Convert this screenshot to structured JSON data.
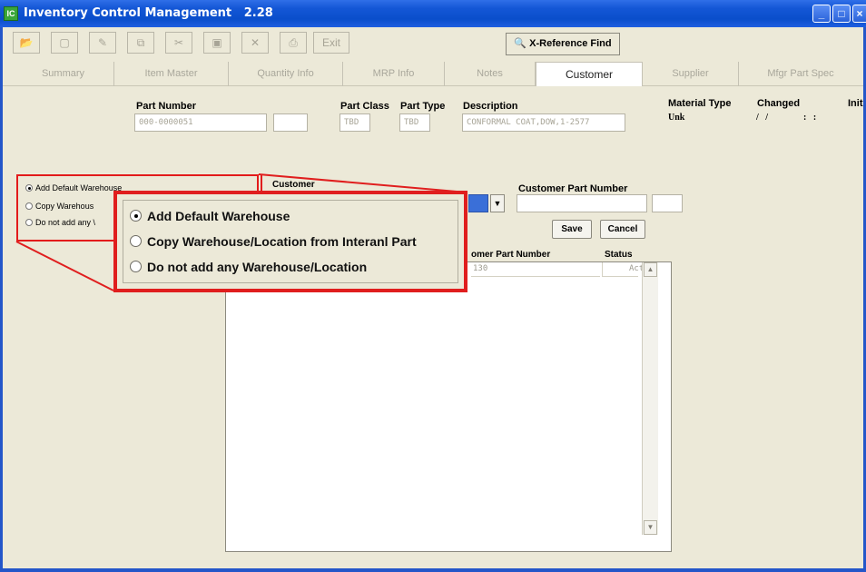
{
  "window": {
    "title": "Inventory Control Management   2.28",
    "app_icon_glyph": "IC"
  },
  "toolbar": {
    "open_icon": "folder-open-icon",
    "new_icon": "new-document-icon",
    "edit_icon": "edit-document-icon",
    "copy_icon": "copy-icon",
    "cut_icon": "scissors-icon",
    "save_icon": "floppy-disk-icon",
    "delete_icon": "delete-x-icon",
    "print_icon": "printer-icon",
    "exit_label": "Exit",
    "xref_label": "X-Reference Find"
  },
  "tabs": [
    {
      "label": "Summary"
    },
    {
      "label": "Item Master"
    },
    {
      "label": "Quantity Info"
    },
    {
      "label": "MRP Info"
    },
    {
      "label": "Notes"
    },
    {
      "label": "Customer",
      "active": true
    },
    {
      "label": "Supplier"
    },
    {
      "label": "Mfgr Part Spec"
    }
  ],
  "header": {
    "part_number_label": "Part Number",
    "part_number_value": "000-0000051",
    "part_class_label": "Part Class",
    "part_class_value": "TBD",
    "part_type_label": "Part Type",
    "part_type_value": "TBD",
    "description_label": "Description",
    "description_value": "CONFORMAL COAT,DOW,1-2577",
    "material_type_label": "Material Type",
    "material_type_value": "Unk",
    "changed_label": "Changed",
    "changed_value": "/   /",
    "changed_time": ":   :",
    "init_label": "Init"
  },
  "radio_small": {
    "opt1": "Add Default Warehouse",
    "opt2": "Copy Warehous",
    "opt3": "Do not add any \\"
  },
  "customer_section": {
    "customer_label": "Customer",
    "customer_part_number_label": "Customer Part Number",
    "save_label": "Save",
    "cancel_label": "Cancel",
    "col_customer_part_number": "omer Part Number",
    "col_status": "Status",
    "row_part_value": "130",
    "row_status_value": "Acti"
  },
  "callout": {
    "opt1": "Add Default Warehouse",
    "opt2": "Copy Warehouse/Location from Interanl Part",
    "opt3": "Do not add any Warehouse/Location"
  },
  "colors": {
    "highlight_red": "#e01e1e",
    "titlebar_blue": "#0a4ecb",
    "dropdown_blue": "#3a6fd8"
  }
}
